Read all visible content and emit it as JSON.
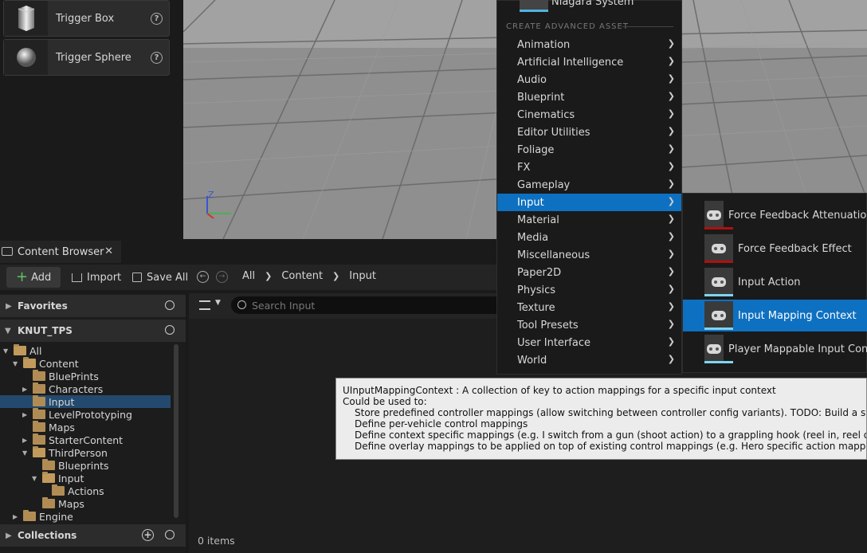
{
  "place_actors": {
    "items": [
      {
        "label": "Trigger Box"
      },
      {
        "label": "Trigger Sphere"
      }
    ]
  },
  "viewport": {
    "axis_label": "Z"
  },
  "content_browser": {
    "tab_label": "Content Browser",
    "toolbar": {
      "add": "Add",
      "import": "Import",
      "save_all": "Save All"
    },
    "breadcrumb": [
      "All",
      "Content",
      "Input"
    ],
    "favorites_label": "Favorites",
    "project_label": "KNUT_TPS",
    "collections_label": "Collections",
    "tree": [
      {
        "label": "All",
        "indent": 0,
        "expanded": true
      },
      {
        "label": "Content",
        "indent": 1,
        "expanded": true
      },
      {
        "label": "BluePrints",
        "indent": 2,
        "expanded": null
      },
      {
        "label": "Characters",
        "indent": 2,
        "expanded": false
      },
      {
        "label": "Input",
        "indent": 2,
        "expanded": null,
        "selected": true
      },
      {
        "label": "LevelPrototyping",
        "indent": 2,
        "expanded": false
      },
      {
        "label": "Maps",
        "indent": 2,
        "expanded": null
      },
      {
        "label": "StarterContent",
        "indent": 2,
        "expanded": false
      },
      {
        "label": "ThirdPerson",
        "indent": 2,
        "expanded": true
      },
      {
        "label": "Blueprints",
        "indent": 3,
        "expanded": null
      },
      {
        "label": "Input",
        "indent": 3,
        "expanded": true
      },
      {
        "label": "Actions",
        "indent": 4,
        "expanded": null
      },
      {
        "label": "Maps",
        "indent": 3,
        "expanded": null
      },
      {
        "label": "Engine",
        "indent": 1,
        "expanded": false
      }
    ],
    "search_placeholder": "Search Input",
    "items_count": "0 items"
  },
  "context_menu": {
    "top_item": "Niagara System",
    "section_header": "CREATE ADVANCED ASSET",
    "items": [
      "Animation",
      "Artificial Intelligence",
      "Audio",
      "Blueprint",
      "Cinematics",
      "Editor Utilities",
      "Foliage",
      "FX",
      "Gameplay",
      "Input",
      "Material",
      "Media",
      "Miscellaneous",
      "Paper2D",
      "Physics",
      "Texture",
      "Tool Presets",
      "User Interface",
      "World"
    ],
    "active_item": "Input"
  },
  "submenu": {
    "items": [
      {
        "label": "Force Feedback Attenuation",
        "bar_color": "#b01010"
      },
      {
        "label": "Force Feedback Effect",
        "bar_color": "#b01010"
      },
      {
        "label": "Input Action",
        "bar_color": "#7fd4f0"
      },
      {
        "label": "Input Mapping Context",
        "bar_color": "#7fd4f0",
        "active": true
      },
      {
        "label": "Player Mappable Input Config",
        "bar_color": "#7fd4f0"
      }
    ]
  },
  "tooltip": {
    "lines": [
      "UInputMappingContext : A collection of key to action mappings for a specific input context",
      "Could be used to:",
      "Store predefined controller mappings (allow switching between controller config variants). TODO: Build a system allowing redirects of UInputMappingContexts to handle this.",
      "Define per-vehicle control mappings",
      "Define context specific mappings (e.g. I switch from a gun (shoot action) to a grappling hook (reel in, reel out, disconnect) or similar)",
      "Define overlay mappings to be applied on top of existing control mappings (e.g. Hero specific action mappings in a MOBA)"
    ]
  },
  "colors": {
    "accent": "#0e70c0",
    "selection": "#234a6e"
  }
}
